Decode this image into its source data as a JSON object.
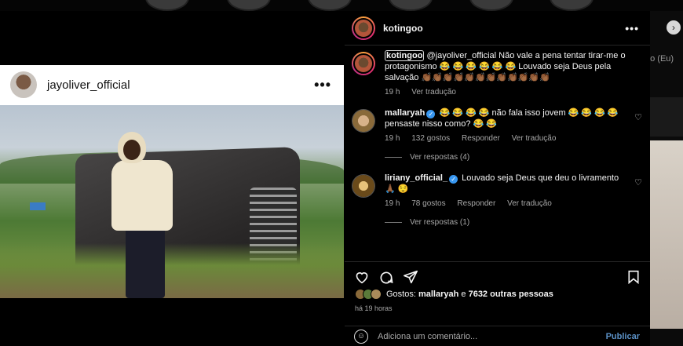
{
  "background": {
    "right_label": "go (Eu)"
  },
  "post_image": {
    "username": "jayoliver_official",
    "more_label": "•••"
  },
  "panel": {
    "username": "kotingoo",
    "more_label": "•••",
    "caption": {
      "user": "kotingoo",
      "text": "@jayoliver_official Não vale a pena tentar tirar-me o protagonismo 😂 😂 😂 😂 😂 😂  Louvado seja Deus pela salvação 👏🏾👏🏾👏🏾👏🏾👏🏾👏🏾👏🏾👏🏾👏🏾👏🏾👏🏾👏🏾",
      "time": "19 h",
      "translate": "Ver tradução"
    },
    "comments": [
      {
        "user": "mallaryah",
        "text": "😂 😂 😂 😂  não fala isso jovem 😂 😂 😂 😂 pensaste nisso como? 😂 😂",
        "time": "19 h",
        "likes": "132 gostos",
        "reply": "Responder",
        "translate": "Ver tradução",
        "view_replies": "Ver respostas (4)"
      },
      {
        "user": "liriany_official_",
        "text": "Louvado seja Deus que deu o livramento 🙏🏾 😌",
        "time": "19 h",
        "likes": "78 gostos",
        "reply": "Responder",
        "translate": "Ver tradução",
        "view_replies": "Ver respostas (1)"
      }
    ],
    "likes_text_prefix": "Gostos: ",
    "likes_user": "mallaryah",
    "likes_conj": " e ",
    "likes_others": "7632 outras pessoas",
    "time_ago": "há 19 horas",
    "comment_placeholder": "Adiciona um comentário...",
    "publish_label": "Publicar"
  },
  "icons": [
    "heart-icon",
    "comment-icon",
    "share-icon",
    "bookmark-icon",
    "emoji-icon",
    "verified-icon",
    "more-icon",
    "chevron-right-icon"
  ]
}
